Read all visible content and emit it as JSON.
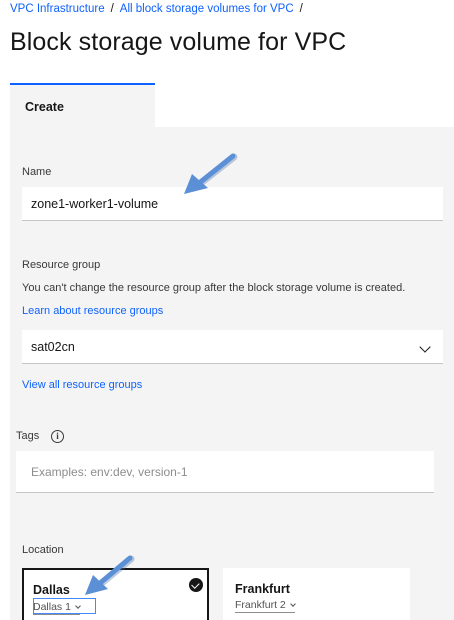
{
  "breadcrumb": {
    "items": [
      "VPC Infrastructure",
      "All block storage volumes for VPC"
    ],
    "separator": "/"
  },
  "page_title": "Block storage volume for VPC",
  "tabs": [
    {
      "label": "Create",
      "selected": true
    }
  ],
  "form": {
    "name": {
      "label": "Name",
      "value": "zone1-worker1-volume"
    },
    "resource_group": {
      "label": "Resource group",
      "helper": "You can't change the resource group after the block storage volume is created.",
      "learn_link": "Learn about resource groups",
      "value": "sat02cn",
      "view_all_link": "View all resource groups"
    },
    "tags": {
      "label": "Tags",
      "placeholder": "Examples: env:dev, version-1",
      "info_icon": "information-icon"
    },
    "location": {
      "label": "Location",
      "tiles": [
        {
          "title": "Dallas",
          "zone": "Dallas 1",
          "selected": true
        },
        {
          "title": "Frankfurt",
          "zone": "Frankfurt 2",
          "selected": false
        }
      ]
    }
  },
  "colors": {
    "link": "#0f62fe",
    "annotation_arrow": "#5b8fd6",
    "panel_bg": "#f4f4f4"
  }
}
